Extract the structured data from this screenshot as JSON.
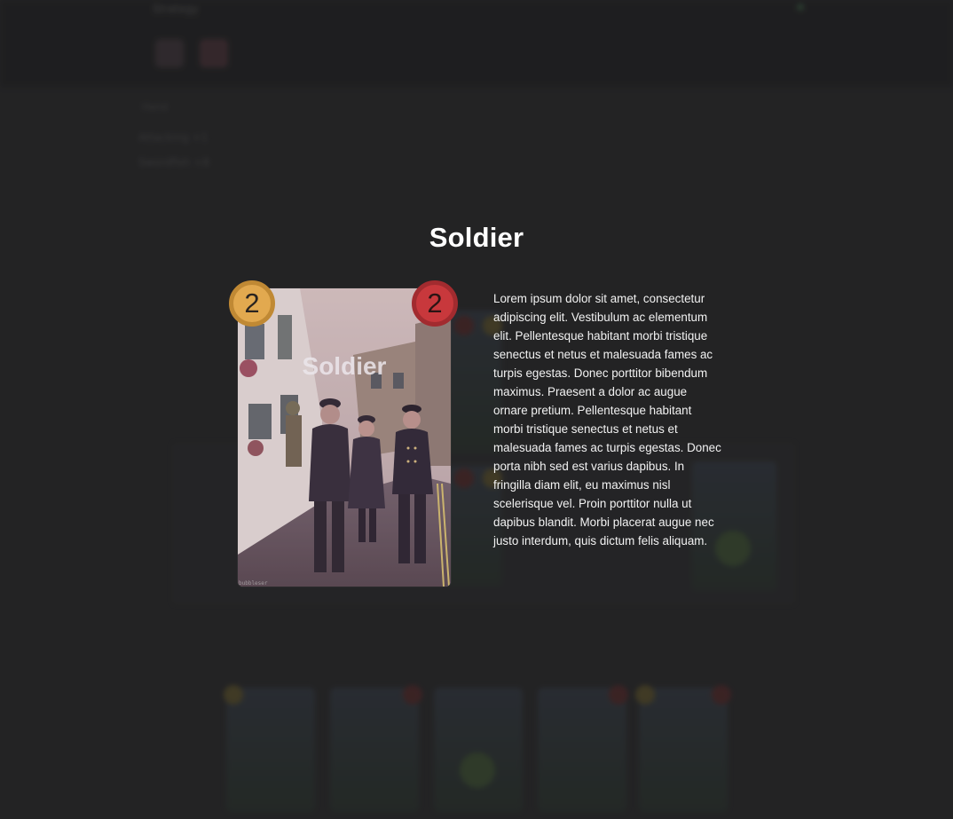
{
  "background": {
    "header_title": "Strategy",
    "section_label": "Hand",
    "list_items": [
      "Attacking +1",
      "Swordfish +8"
    ]
  },
  "modal": {
    "title": "Soldier",
    "card": {
      "name": "Soldier",
      "cost": "2",
      "power": "2",
      "watermark": "bubbleser",
      "cost_color": "#e2a94f",
      "power_color": "#c8383c"
    },
    "description": "Lorem ipsum dolor sit amet, consectetur adipiscing elit. Vestibulum ac elementum elit. Pellentesque habitant morbi tristique senectus et netus et malesuada fames ac turpis egestas. Donec porttitor bibendum maximus. Praesent a dolor ac augue ornare pretium. Pellentesque habitant morbi tristique senectus et netus et malesuada fames ac turpis egestas. Donec porta nibh sed est varius dapibus. In fringilla diam elit, eu maximus nisl scelerisque vel. Proin porttitor nulla ut dapibus blandit. Morbi placerat augue nec justo interdum, quis dictum felis aliquam."
  }
}
